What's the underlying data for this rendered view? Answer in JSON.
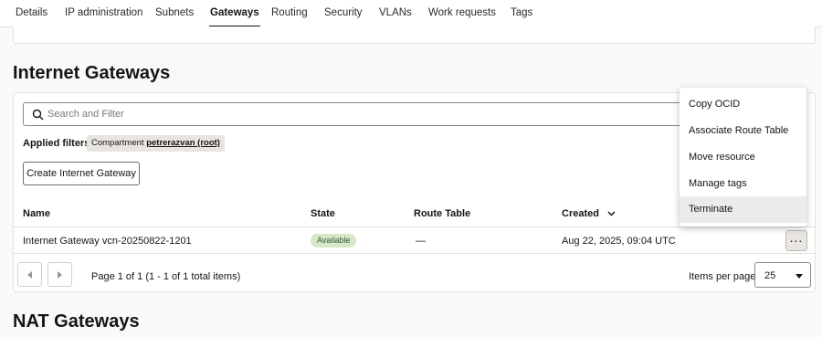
{
  "tabs": [
    {
      "label": "Details",
      "active": false
    },
    {
      "label": "IP administration",
      "active": false
    },
    {
      "label": "Subnets",
      "active": false
    },
    {
      "label": "Gateways",
      "active": true
    },
    {
      "label": "Routing",
      "active": false
    },
    {
      "label": "Security",
      "active": false
    },
    {
      "label": "VLANs",
      "active": false
    },
    {
      "label": "Work requests",
      "active": false
    },
    {
      "label": "Tags",
      "active": false
    }
  ],
  "internet_gateways": {
    "title": "Internet Gateways",
    "search_placeholder": "Search and Filter",
    "applied_filters_label": "Applied filters",
    "filter_chip": {
      "key": "Compartment",
      "value": "petrerazvan (root)"
    },
    "create_button": "Create Internet Gateway",
    "columns": [
      "Name",
      "State",
      "Route Table",
      "Created"
    ],
    "rows": [
      {
        "name": "Internet Gateway vcn-20250822-1201",
        "state": "Available",
        "route_table": "—",
        "created": "Aug 22, 2025, 09:04 UTC",
        "actions_label": "..."
      }
    ],
    "pagination": {
      "info": "Page 1 of 1 (1 - 1 of 1 total items)",
      "items_per_page_label": "Items per page",
      "items_per_page_value": "25"
    }
  },
  "actions_menu": {
    "items": [
      "Copy OCID",
      "Associate Route Table",
      "Move resource",
      "Manage tags",
      "Terminate"
    ],
    "hovered": "Terminate"
  },
  "nat_gateways": {
    "title": "NAT Gateways"
  },
  "colors": {
    "page_bg": "#fbf9f8",
    "badge_bg": "#d5e8c8",
    "badge_text": "#36533a",
    "active_tab_underline": "#161513"
  }
}
